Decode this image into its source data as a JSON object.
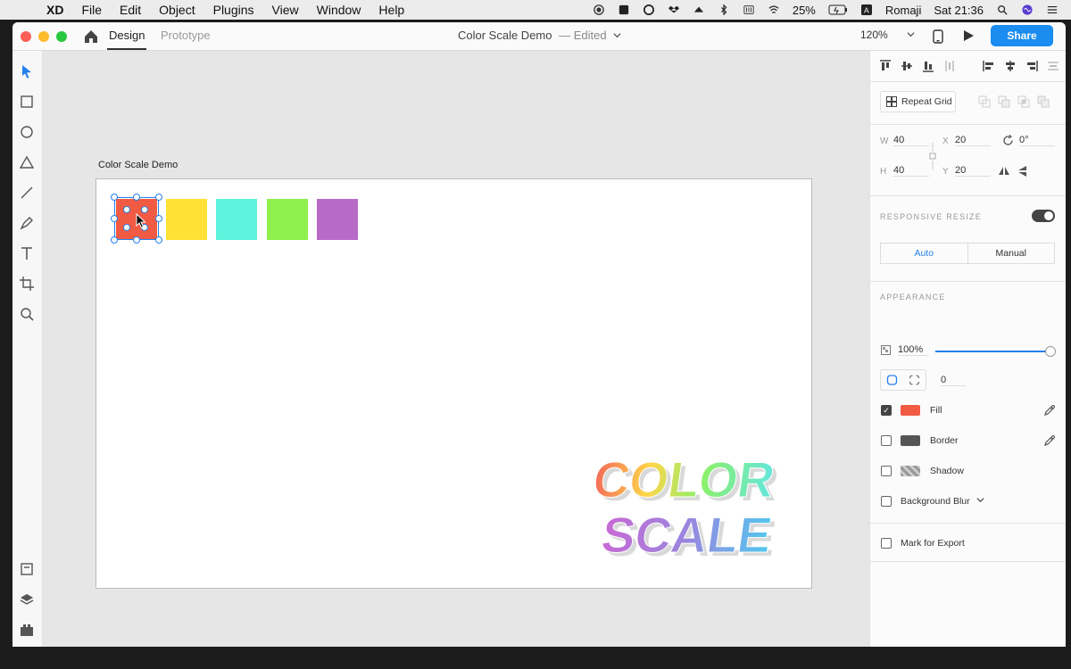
{
  "menubar": {
    "app_name": "XD",
    "items": [
      "File",
      "Edit",
      "Object",
      "Plugins",
      "View",
      "Window",
      "Help"
    ],
    "battery": "25%",
    "input_method": "Romaji",
    "clock": "Sat 21:36"
  },
  "window": {
    "tabs": [
      "Design",
      "Prototype"
    ],
    "doc_title": "Color Scale Demo",
    "doc_status": "— Edited",
    "zoom": "120%",
    "share_label": "Share"
  },
  "canvas": {
    "artboard_name": "Color Scale Demo",
    "swatches": [
      "#f15a43",
      "#ffe135",
      "#5cf2db",
      "#8df04c",
      "#b86ac9"
    ],
    "logo_lines": [
      "COLOR",
      "SCALE"
    ]
  },
  "inspector": {
    "repeat_grid_label": "Repeat Grid",
    "w_label": "W",
    "w": "40",
    "x_label": "X",
    "x": "20",
    "h_label": "H",
    "h": "40",
    "y_label": "Y",
    "y": "20",
    "rotation": "0°",
    "responsive_title": "RESPONSIVE RESIZE",
    "resize_modes": [
      "Auto",
      "Manual"
    ],
    "appearance_title": "APPEARANCE",
    "opacity": "100%",
    "corner_radius": "0",
    "fill_label": "Fill",
    "fill_color": "#f15a43",
    "border_label": "Border",
    "shadow_label": "Shadow",
    "blur_label": "Background Blur",
    "export_label": "Mark for Export"
  },
  "colors": {
    "accent": "#2680eb",
    "share": "#1b8cf0"
  }
}
